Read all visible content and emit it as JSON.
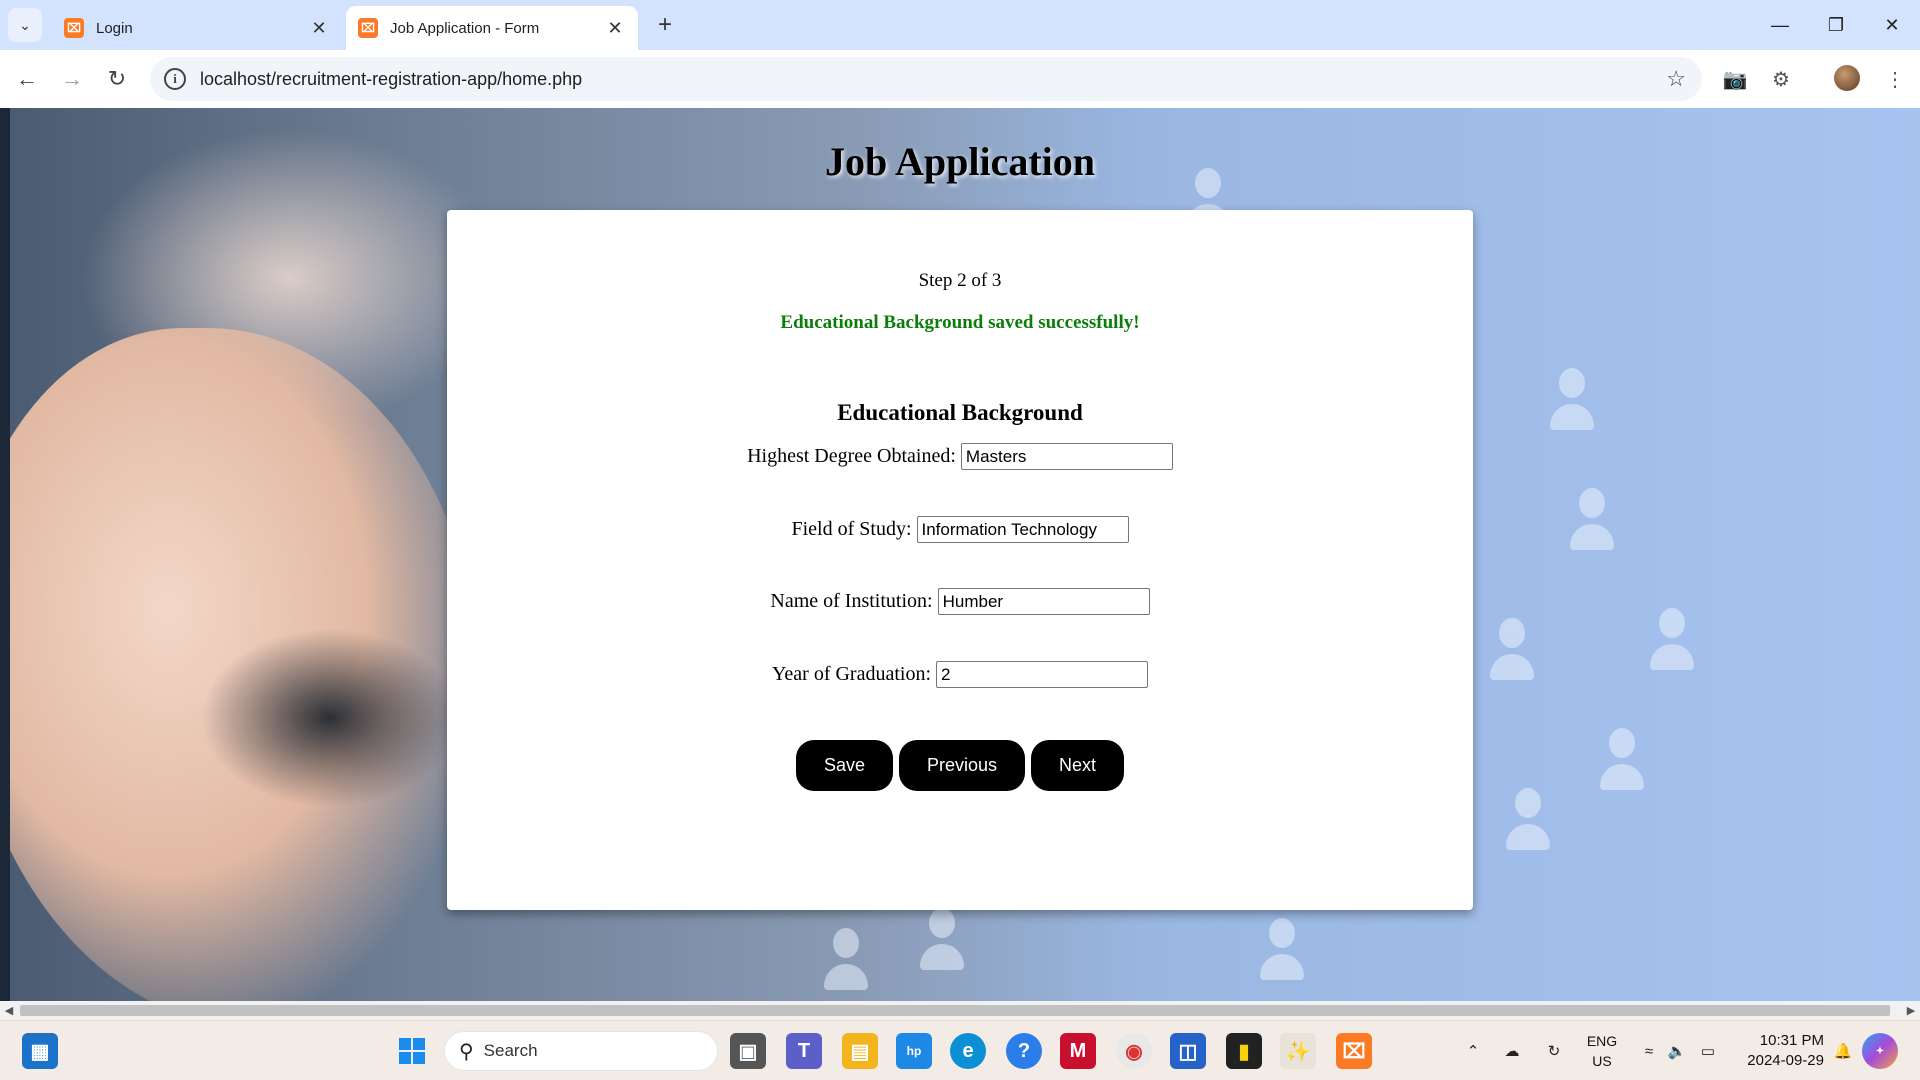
{
  "browser": {
    "tabs": [
      {
        "title": "Login",
        "active": false
      },
      {
        "title": "Job Application - Form",
        "active": true
      }
    ],
    "url": "localhost/recruitment-registration-app/home.php"
  },
  "page": {
    "title": "Job Application",
    "step_text": "Step 2 of 3",
    "success_message": "Educational Background saved successfully!",
    "section_title": "Educational Background",
    "fields": [
      {
        "label": "Highest Degree Obtained:",
        "value": "Masters"
      },
      {
        "label": "Field of Study:",
        "value": "Information Technology"
      },
      {
        "label": "Name of Institution:",
        "value": "Humber"
      },
      {
        "label": "Year of Graduation:",
        "value": "2"
      }
    ],
    "buttons": {
      "save": "Save",
      "previous": "Previous",
      "next": "Next"
    }
  },
  "taskbar": {
    "search_placeholder": "Search",
    "language": {
      "line1": "ENG",
      "line2": "US"
    },
    "time": "10:31 PM",
    "date": "2024-09-29"
  },
  "colors": {
    "success": "#0a7d0a",
    "button_bg": "#000000",
    "tab_strip": "#d3e3fd",
    "xampp_orange": "#fb7a24"
  },
  "icons": [
    "tab-search-icon",
    "xampp-favicon-icon",
    "close-icon",
    "plus-icon",
    "back-icon",
    "forward-icon",
    "reload-icon",
    "site-info-icon",
    "star-icon",
    "camera-icon",
    "extensions-icon",
    "kebab-menu-icon",
    "windows-start-icon",
    "search-icon"
  ]
}
